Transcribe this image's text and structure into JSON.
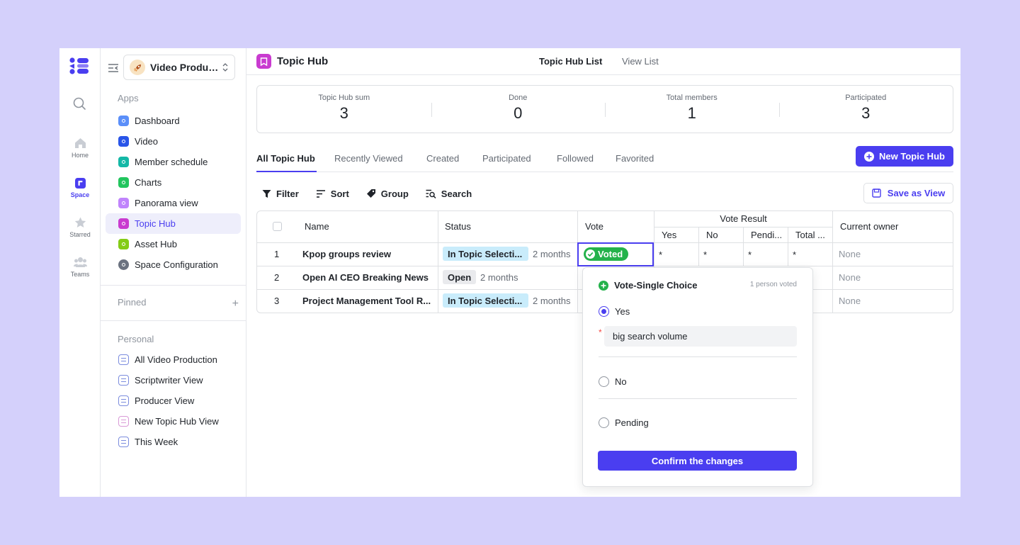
{
  "rail": {
    "items": [
      {
        "label": "Home"
      },
      {
        "label": "Space"
      },
      {
        "label": "Starred"
      },
      {
        "label": "Teams"
      }
    ]
  },
  "sidebar": {
    "space_name": "Video Production",
    "apps_title": "Apps",
    "apps": [
      {
        "label": "Dashboard",
        "color": "#5b8ff9"
      },
      {
        "label": "Video",
        "color": "#2955e8"
      },
      {
        "label": "Member schedule",
        "color": "#14b8a6"
      },
      {
        "label": "Charts",
        "color": "#22c55e"
      },
      {
        "label": "Panorama view",
        "color": "#c084fc"
      },
      {
        "label": "Topic Hub",
        "color": "#c93bd0"
      },
      {
        "label": "Asset Hub",
        "color": "#84cc16"
      },
      {
        "label": "Space Configuration",
        "color": "#6b7280"
      }
    ],
    "pinned_title": "Pinned",
    "personal_title": "Personal",
    "personal": [
      {
        "label": "All Video Production"
      },
      {
        "label": "Scriptwriter View"
      },
      {
        "label": "Producer View"
      },
      {
        "label": "New Topic Hub View"
      },
      {
        "label": "This Week"
      }
    ]
  },
  "header": {
    "title": "Topic Hub",
    "tabs": [
      "Topic Hub List",
      "View List"
    ]
  },
  "stats": [
    {
      "label": "Topic Hub sum",
      "value": "3"
    },
    {
      "label": "Done",
      "value": "0"
    },
    {
      "label": "Total members",
      "value": "1"
    },
    {
      "label": "Participated",
      "value": "3"
    }
  ],
  "tabs": [
    "All Topic Hub",
    "Recently Viewed",
    "Created",
    "Participated",
    "Followed",
    "Favorited"
  ],
  "new_button": "New Topic Hub",
  "toolbar": {
    "filter": "Filter",
    "sort": "Sort",
    "group": "Group",
    "search": "Search",
    "save_view": "Save as View"
  },
  "table": {
    "headers": {
      "name": "Name",
      "status": "Status",
      "vote": "Vote",
      "vote_result": "Vote Result",
      "yes": "Yes",
      "no": "No",
      "pending": "Pendi...",
      "total": "Total ...",
      "owner": "Current owner"
    },
    "rows": [
      {
        "num": "1",
        "name": "Kpop groups review",
        "status": "In Topic Selecti...",
        "age": "2 months",
        "vote": "Voted",
        "yes": "*",
        "no": "*",
        "pending": "*",
        "total": "*",
        "owner": "None"
      },
      {
        "num": "2",
        "name": "Open AI CEO Breaking News",
        "status": "Open",
        "age": "2 months",
        "owner": "None"
      },
      {
        "num": "3",
        "name": "Project Management Tool R...",
        "status": "In Topic Selecti...",
        "age": "2 months",
        "owner": "None"
      }
    ]
  },
  "vote_popover": {
    "title": "Vote-Single Choice",
    "count": "1 person voted",
    "options": [
      "Yes",
      "No",
      "Pending"
    ],
    "selected": "Yes",
    "reason": "big search volume",
    "required_mark": "*",
    "confirm": "Confirm the changes"
  },
  "colors": {
    "accent": "#4a3ef0",
    "voted": "#24b24b",
    "status_blue": "#c9ecfb"
  }
}
